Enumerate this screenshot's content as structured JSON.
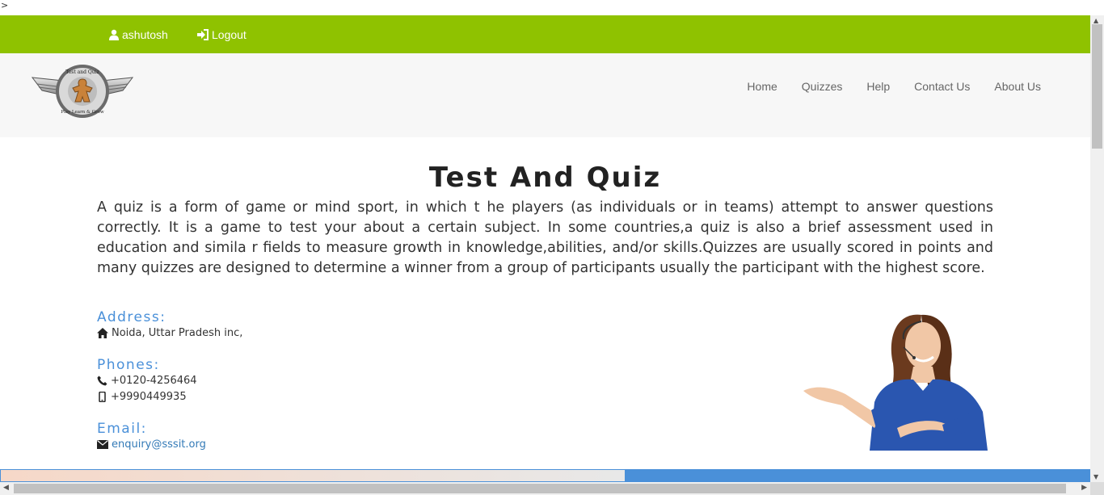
{
  "stray_text": ">",
  "topbar": {
    "user_label": "ashutosh",
    "logout_label": "Logout"
  },
  "logo": {
    "top_text": "Test and Quiz",
    "bottom_text": "Play Learn & Grow"
  },
  "nav": {
    "items": [
      "Home",
      "Quizzes",
      "Help",
      "Contact Us",
      "About Us"
    ]
  },
  "main": {
    "title": "Test And Quiz",
    "description": "A quiz is a form of game or mind sport, in which t he players (as individuals or in teams) attempt to answer questions correctly. It is a game to test your about a certain subject. In some countries,a quiz is also a brief assessment used in education and simila r fields to measure growth in knowledge,abilities, and/or skills.Quizzes are usually scored in points and many quizzes are designed to determine a winner from a group of participants usually the participant with the highest score."
  },
  "contact": {
    "address_heading": "Address:",
    "address": "Noida, Uttar Pradesh inc,",
    "phones_heading": "Phones:",
    "phone1": "+0120-4256464",
    "phone2": "+9990449935",
    "email_heading": "Email:",
    "email": "enquiry@sssit.org"
  },
  "icons": {
    "user": "user-icon",
    "logout": "logout-icon",
    "home": "home-icon",
    "phone": "phone-icon",
    "mobile": "mobile-icon",
    "envelope": "envelope-icon"
  },
  "colors": {
    "topbar": "#8fc200",
    "heading_blue": "#4a90d9",
    "link": "#337ab7"
  }
}
